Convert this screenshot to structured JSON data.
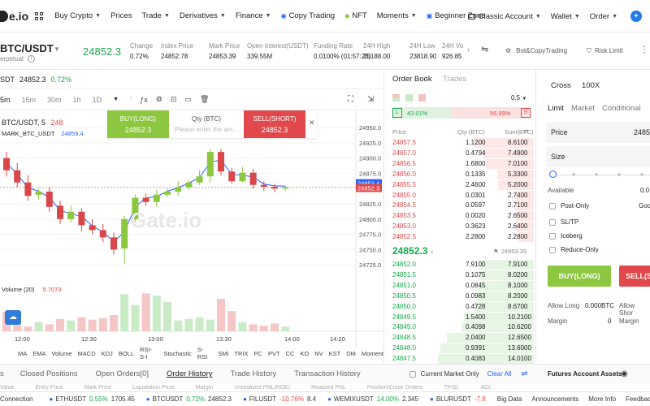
{
  "nav": {
    "logo": "e.io",
    "menu": [
      {
        "label": "Buy Crypto",
        "caret": true
      },
      {
        "label": "Prices",
        "caret": false
      },
      {
        "label": "Trade",
        "caret": true
      },
      {
        "label": "Derivatives",
        "caret": true
      },
      {
        "label": "Finance",
        "caret": true
      },
      {
        "label": "Copy Trading",
        "caret": false
      },
      {
        "label": "NFT",
        "caret": false
      },
      {
        "label": "Moments",
        "caret": true
      },
      {
        "label": "Beginner Zone",
        "caret": false
      }
    ],
    "account": "Classic Account",
    "wallet": "Wallet",
    "order": "Order"
  },
  "ticker": {
    "pair": "BTC/USDT",
    "pair_sub": "erpetual",
    "last": "24852.3",
    "stats": [
      {
        "label": "Change",
        "value": "0.72%"
      },
      {
        "label": "Index Price",
        "value": "24852.78"
      },
      {
        "label": "Mark Price",
        "value": "24853.39"
      },
      {
        "label": "Open Interest(USDT)",
        "value": "339.55M"
      },
      {
        "label": "Funding Rate",
        "value": "0.0100% (01:57:25)"
      },
      {
        "label": "24H High",
        "value": "25188.00"
      },
      {
        "label": "24H Low",
        "value": "23818.90"
      },
      {
        "label": "24H Vo",
        "value": "926.85"
      }
    ],
    "copytrading": "Bot&CopyTrading",
    "risk": "Risk Limit"
  },
  "chart_top": {
    "sym": "SDT",
    "price": "24852.3",
    "change": "0.72%"
  },
  "toolbar": {
    "timeframes": [
      "5m",
      "15m",
      "30m",
      "1h",
      "1D"
    ]
  },
  "order_panel_overlay": {
    "buy_label": "BUY(LONG)",
    "buy_price": "24852.3",
    "qty_label": "Qty (BTC)",
    "qty_placeholder": "Please enter the am...",
    "sell_label": "SELL(SHORT)",
    "sell_price": "24852.3"
  },
  "chart": {
    "legend_main": "BTC/USDT, 5",
    "legend_main_val": "248",
    "legend_mark": "MARK_BTC_USDT",
    "legend_mark_val": "24859.4",
    "watermark": "Gate.io",
    "yticks": [
      "24950.0",
      "24925.0",
      "24900.0",
      "24875.0",
      "24850.0",
      "24825.0",
      "24800.0",
      "24775.0",
      "24750.0",
      "24725.0"
    ],
    "price_tag_mark": "24853.4",
    "price_tag_last": "24852.3",
    "xticks": [
      "12:00",
      "12:30",
      "13:00",
      "13:30",
      "14:00",
      "14:20"
    ],
    "volume_label": "Volume (20)",
    "volume_value": "5.7073"
  },
  "indicators": [
    "MA",
    "EMA",
    "Volume",
    "MACD",
    "KDJ",
    "BOLL",
    "RSI-S-I",
    "Stochastic",
    "S-RSI",
    "SMI",
    "TRIX",
    "PC",
    "PVT",
    "CC",
    "KO",
    "NV",
    "KST",
    "DM",
    "Moment"
  ],
  "orderbook": {
    "tab_active": "Order Book",
    "tab_other": "Trades",
    "precision": "0.5",
    "long_pct": "43.01%",
    "short_pct": "56.99%",
    "col_price": "Price",
    "col_qty": "Qty (BTC)",
    "col_sum": "Sum(BTC)",
    "asks": [
      {
        "price": "24857.5",
        "qty": "1.1200",
        "sum": "8.6100"
      },
      {
        "price": "24857.0",
        "qty": "0.4794",
        "sum": "7.4900"
      },
      {
        "price": "24856.5",
        "qty": "1.6800",
        "sum": "7.0100"
      },
      {
        "price": "24856.0",
        "qty": "0.1335",
        "sum": "5.3300"
      },
      {
        "price": "24855.5",
        "qty": "2.4600",
        "sum": "5.2000"
      },
      {
        "price": "24855.0",
        "qty": "0.0301",
        "sum": "2.7400"
      },
      {
        "price": "24854.5",
        "qty": "0.0597",
        "sum": "2.7100"
      },
      {
        "price": "24853.5",
        "qty": "0.0020",
        "sum": "2.6500"
      },
      {
        "price": "24853.0",
        "qty": "0.3623",
        "sum": "2.6400"
      },
      {
        "price": "24852.5",
        "qty": "2.2800",
        "sum": "2.2800"
      }
    ],
    "last": "24852.3",
    "mark": "24853.39",
    "bids": [
      {
        "price": "24852.0",
        "qty": "7.9100",
        "sum": "7.9100"
      },
      {
        "price": "24851.5",
        "qty": "0.1075",
        "sum": "8.0200"
      },
      {
        "price": "24851.0",
        "qty": "0.0845",
        "sum": "8.1000"
      },
      {
        "price": "24850.5",
        "qty": "0.0983",
        "sum": "8.2000"
      },
      {
        "price": "24850.0",
        "qty": "0.4728",
        "sum": "8.6700"
      },
      {
        "price": "24849.5",
        "qty": "1.5400",
        "sum": "10.2100"
      },
      {
        "price": "24849.0",
        "qty": "0.4098",
        "sum": "10.6200"
      },
      {
        "price": "24848.5",
        "qty": "2.0400",
        "sum": "12.6500"
      },
      {
        "price": "24848.0",
        "qty": "0.9391",
        "sum": "13.6000"
      },
      {
        "price": "24847.5",
        "qty": "0.4083",
        "sum": "14.0100"
      }
    ]
  },
  "trade_panel": {
    "mode": "Cross",
    "leverage": "100X",
    "tabs": [
      "Limit",
      "Market",
      "Conditional"
    ],
    "price_label": "Price",
    "price_value": "2485",
    "size_label": "Size",
    "available_label": "Available",
    "available_value": "0.0",
    "options": [
      "Post-Only",
      "SL/TP",
      "Iceberg",
      "Reduce-Only"
    ],
    "good": "Goo",
    "buy_btn": "BUY(LONG)",
    "sell_btn": "SELL(S",
    "allow_long_label": "Allow Long",
    "allow_long_value": "0.000BTC",
    "allow_short_label": "Allow Shor",
    "margin_label": "Margin",
    "margin_value": "0"
  },
  "bottom_tabs": [
    "Closed Positions",
    "Open Orders[0]",
    "Order History",
    "Trade History",
    "Transaction History"
  ],
  "bottom_tab_first": "s",
  "current_market_only": "Current Market Only",
  "clear_all": "Clear All",
  "futures_assets": "Futures Account Assets",
  "bottom_headers": [
    "Value",
    "Entry Price",
    "Mark Price",
    "Liquidation Price",
    "Margin",
    "Unrealized PNL(ROE)",
    "Realized PNL",
    "Position/Close Orders",
    "TP/SL",
    "ADL"
  ],
  "footer": {
    "connection": "Connection",
    "tickers": [
      {
        "sym": "ETHUSDT",
        "chg": "0.55%",
        "price": "1705.45"
      },
      {
        "sym": "BTCUSDT",
        "chg": "0.72%",
        "price": "24852.3"
      },
      {
        "sym": "FILUSDT",
        "chg": "-10.76%",
        "price": "8.4"
      },
      {
        "sym": "WEMIXUSDT",
        "chg": "14.00%",
        "price": "2.345"
      },
      {
        "sym": "BLURUSDT",
        "chg": "-7.8",
        "price": ""
      }
    ],
    "links": [
      "Big Data",
      "Announcements",
      "More Info",
      "Feedback"
    ]
  },
  "chart_data": {
    "type": "candlestick",
    "candles": [
      {
        "o": 24900,
        "c": 24880,
        "h": 24910,
        "l": 24870
      },
      {
        "o": 24880,
        "c": 24860,
        "h": 24892,
        "l": 24852
      },
      {
        "o": 24860,
        "c": 24838,
        "h": 24872,
        "l": 24830
      },
      {
        "o": 24840,
        "c": 24845,
        "h": 24850,
        "l": 24832
      },
      {
        "o": 24845,
        "c": 24820,
        "h": 24852,
        "l": 24812
      },
      {
        "o": 24822,
        "c": 24800,
        "h": 24830,
        "l": 24792
      },
      {
        "o": 24800,
        "c": 24812,
        "h": 24822,
        "l": 24795
      },
      {
        "o": 24812,
        "c": 24790,
        "h": 24818,
        "l": 24780
      },
      {
        "o": 24790,
        "c": 24782,
        "h": 24800,
        "l": 24775
      },
      {
        "o": 24782,
        "c": 24770,
        "h": 24792,
        "l": 24762
      },
      {
        "o": 24770,
        "c": 24750,
        "h": 24778,
        "l": 24742
      },
      {
        "o": 24752,
        "c": 24800,
        "h": 24805,
        "l": 24727
      },
      {
        "o": 24800,
        "c": 24835,
        "h": 24840,
        "l": 24795
      },
      {
        "o": 24835,
        "c": 24828,
        "h": 24842,
        "l": 24822
      },
      {
        "o": 24828,
        "c": 24840,
        "h": 24848,
        "l": 24820
      },
      {
        "o": 24840,
        "c": 24845,
        "h": 24850,
        "l": 24836
      },
      {
        "o": 24845,
        "c": 24852,
        "h": 24862,
        "l": 24838
      },
      {
        "o": 24852,
        "c": 24860,
        "h": 24864,
        "l": 24848
      },
      {
        "o": 24860,
        "c": 24870,
        "h": 24880,
        "l": 24856
      },
      {
        "o": 24870,
        "c": 24910,
        "h": 24915,
        "l": 24860
      },
      {
        "o": 24910,
        "c": 24878,
        "h": 24915,
        "l": 24872
      },
      {
        "o": 24878,
        "c": 24862,
        "h": 24884,
        "l": 24858
      },
      {
        "o": 24862,
        "c": 24876,
        "h": 24885,
        "l": 24860
      },
      {
        "o": 24876,
        "c": 24856,
        "h": 24882,
        "l": 24850
      },
      {
        "o": 24856,
        "c": 24853,
        "h": 24862,
        "l": 24846
      },
      {
        "o": 24853,
        "c": 24850,
        "h": 24858,
        "l": 24844
      },
      {
        "o": 24850,
        "c": 24852,
        "h": 24855,
        "l": 24846
      }
    ],
    "ylim": [
      24712,
      24970
    ],
    "volumes": [
      2.5,
      0.8,
      0.6,
      1.2,
      0.9,
      1.6,
      1.4,
      1.8,
      1.5,
      1.7,
      2.1,
      4.8,
      3.4,
      4.9,
      4.6,
      3.8,
      1.4,
      1.6,
      1.8,
      1.5,
      4.2,
      2.6,
      1.2,
      0.9,
      0.7,
      1.0,
      0.6
    ],
    "vol_ylim": [
      0,
      6.5
    ]
  }
}
